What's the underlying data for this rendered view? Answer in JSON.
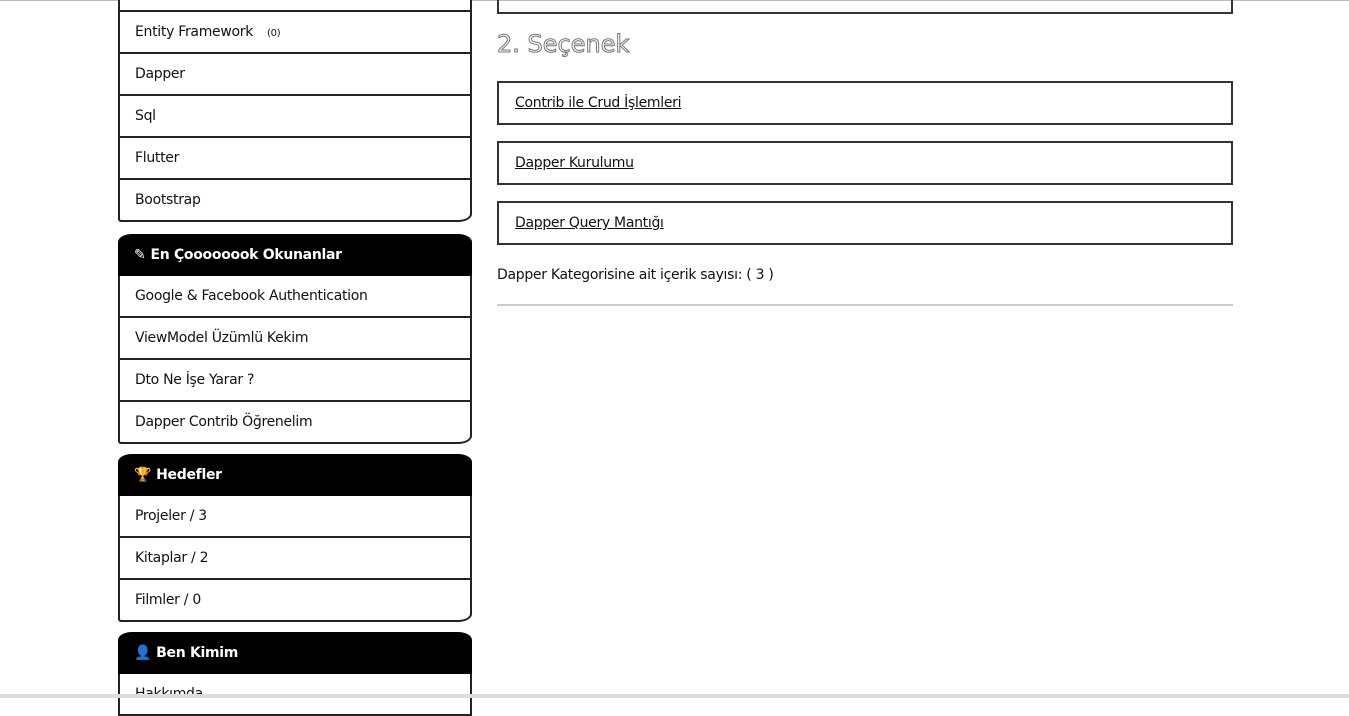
{
  "sidebar": {
    "categories": {
      "items": [
        {
          "label": "Entity Framework",
          "count": "(0)"
        },
        {
          "label": "Dapper"
        },
        {
          "label": "Sql"
        },
        {
          "label": "Flutter"
        },
        {
          "label": "Bootstrap"
        }
      ]
    },
    "most_read": {
      "title": "En Çoooooook Okunanlar",
      "icon": "pencil-icon",
      "items": [
        "Google & Facebook Authentication",
        "ViewModel Üzümlü Kekim",
        "Dto Ne İşe Yarar ?",
        "Dapper Contrib Öğrenelim"
      ]
    },
    "goals": {
      "title": "Hedefler",
      "icon": "trophy-icon",
      "items": [
        "Projeler / 3",
        "Kitaplar / 2",
        "Filmler / 0"
      ]
    },
    "about": {
      "title": "Ben Kimim",
      "icon": "user-icon",
      "items": [
        "Hakkımda"
      ]
    }
  },
  "main": {
    "section_title": "2. Seçenek",
    "posts": [
      "Contrib ile Crud İşlemleri",
      "Dapper Kurulumu",
      "Dapper Query Mantığı"
    ],
    "category_count_text": "Dapper Kategorisine ait içerik sayısı: ( 3 )"
  }
}
